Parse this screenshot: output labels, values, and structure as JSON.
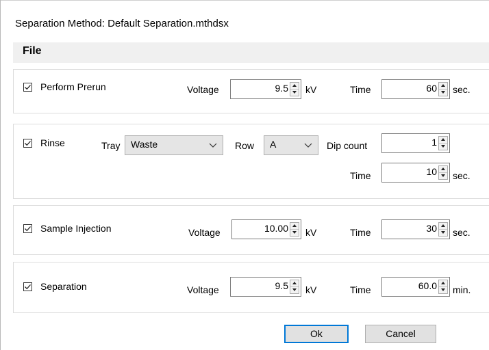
{
  "window": {
    "title": "Separation Method: Default Separation.mthdsx"
  },
  "menu": {
    "file": "File"
  },
  "prerun": {
    "label": "Perform Prerun",
    "checked": true,
    "voltage_label": "Voltage",
    "voltage_value": "9.5",
    "voltage_unit": "kV",
    "time_label": "Time",
    "time_value": "60",
    "time_unit": "sec."
  },
  "rinse": {
    "label": "Rinse",
    "checked": true,
    "tray_label": "Tray",
    "tray_value": "Waste",
    "row_label": "Row",
    "row_value": "A",
    "dip_label": "Dip count",
    "dip_value": "1",
    "time_label": "Time",
    "time_value": "10",
    "time_unit": "sec."
  },
  "injection": {
    "label": "Sample Injection",
    "checked": true,
    "voltage_label": "Voltage",
    "voltage_value": "10.00",
    "voltage_unit": "kV",
    "time_label": "Time",
    "time_value": "30",
    "time_unit": "sec."
  },
  "separation": {
    "label": "Separation",
    "checked": true,
    "voltage_label": "Voltage",
    "voltage_value": "9.5",
    "voltage_unit": "kV",
    "time_label": "Time",
    "time_value": "60.0",
    "time_unit": "min."
  },
  "buttons": {
    "ok": "Ok",
    "cancel": "Cancel"
  },
  "colors": {
    "accent": "#0078d7",
    "menubar": "#f0f0f0",
    "button": "#e1e1e1"
  }
}
